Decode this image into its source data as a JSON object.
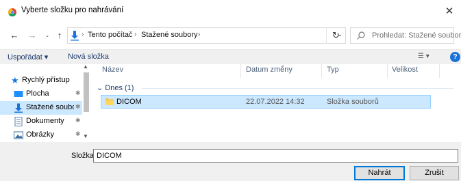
{
  "window": {
    "title": "Vyberte složku pro nahrávání",
    "close_glyph": "✕"
  },
  "nav": {
    "back_glyph": "←",
    "forward_glyph": "→",
    "recent_glyph": "⌄",
    "up_glyph": "↑",
    "crumbs": [
      "Tento počítač",
      "Stažené soubory"
    ],
    "crumb_separator": "›",
    "dropdown_glyph": "⌄",
    "refresh_glyph": "↻",
    "search_placeholder": "Prohledat: Stažené soubory"
  },
  "toolbar": {
    "organize_label": "Uspořádat ▾",
    "new_folder_label": "Nová složka",
    "view_glyph": "☰ ▾",
    "help_glyph": "?"
  },
  "sidebar": {
    "items": [
      {
        "label": "Rychlý přístup",
        "icon": "star-icon",
        "color": "#1a73d9"
      },
      {
        "label": "Plocha",
        "icon": "desktop-icon",
        "color": "#1e90ff",
        "pin": "✱"
      },
      {
        "label": "Stažené soubory",
        "icon": "download-icon",
        "color": "#1a73d9",
        "pin": "✱",
        "selected": true
      },
      {
        "label": "Dokumenty",
        "icon": "document-icon",
        "color": "#5b7fa6",
        "pin": "✱"
      },
      {
        "label": "Obrázky",
        "icon": "pictures-icon",
        "color": "#3c6e9f",
        "pin": "✱"
      }
    ],
    "scroll_up": "▲",
    "scroll_down": "▼"
  },
  "filelist": {
    "columns": [
      "Název",
      "Datum změny",
      "Typ",
      "Velikost"
    ],
    "sort_glyph": "⌄",
    "group": "Dnes (1)",
    "group_glyph": "⌄",
    "rows": [
      {
        "name": "DICOM",
        "date": "22.07.2022 14:32",
        "type": "Složka souborů",
        "size": ""
      }
    ]
  },
  "bottom": {
    "folder_label": "Složka:",
    "folder_value": "DICOM",
    "upload_label": "Nahrát",
    "cancel_label": "Zrušit"
  },
  "colors": {
    "accent": "#0078d7",
    "selection": "#cce8ff",
    "folder": "#f5c542"
  }
}
